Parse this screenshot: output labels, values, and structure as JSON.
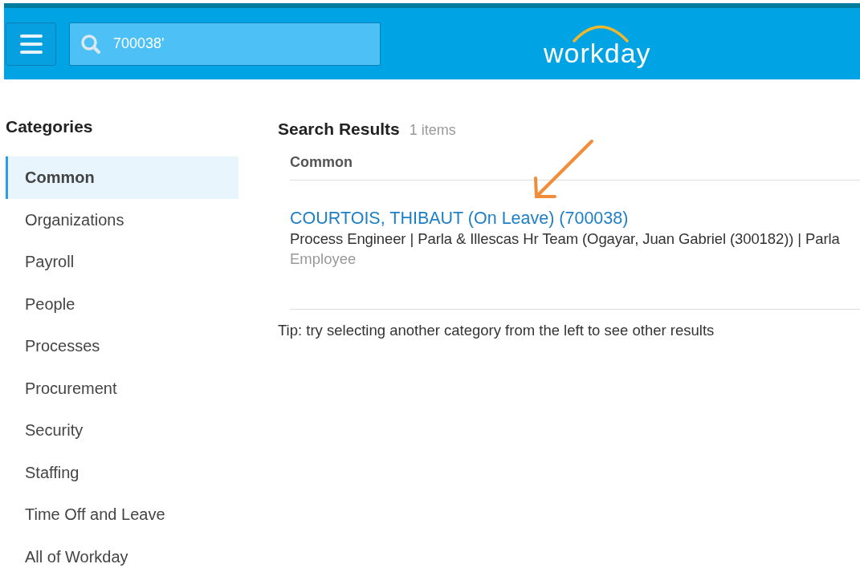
{
  "header": {
    "search": {
      "value": "700038'"
    },
    "logo": "workday"
  },
  "sidebar": {
    "title": "Categories",
    "items": [
      {
        "label": "Common",
        "selected": true
      },
      {
        "label": "Organizations",
        "selected": false
      },
      {
        "label": "Payroll",
        "selected": false
      },
      {
        "label": "People",
        "selected": false
      },
      {
        "label": "Processes",
        "selected": false
      },
      {
        "label": "Procurement",
        "selected": false
      },
      {
        "label": "Security",
        "selected": false
      },
      {
        "label": "Staffing",
        "selected": false
      },
      {
        "label": "Time Off and Leave",
        "selected": false
      },
      {
        "label": "All of Workday",
        "selected": false
      }
    ]
  },
  "results": {
    "title": "Search Results",
    "count": "1 items",
    "section": "Common",
    "items": [
      {
        "name": "COURTOIS, THIBAUT (On Leave) (700038)",
        "details": "Process Engineer | Parla & Illescas Hr Team (Ogayar, Juan Gabriel (300182)) | Parla",
        "type": "Employee"
      }
    ],
    "tip": "Tip: try selecting another category from the left to see other results"
  }
}
